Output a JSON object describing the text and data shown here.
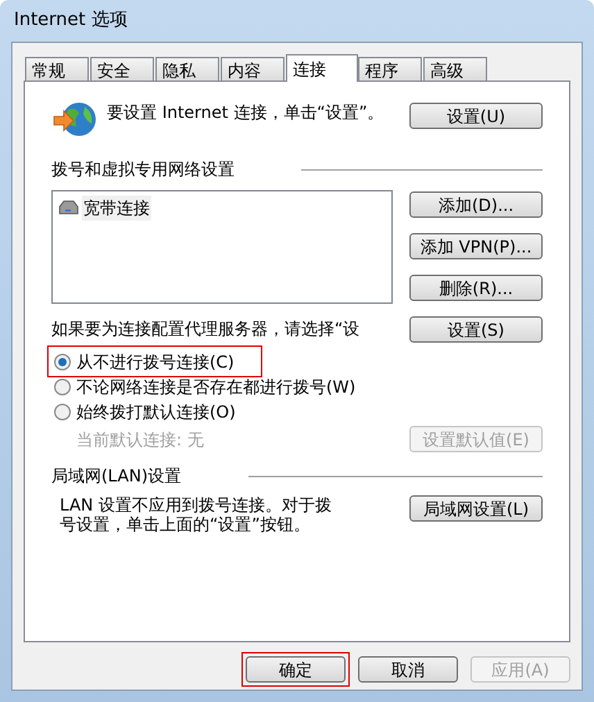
{
  "window": {
    "title": "Internet 选项"
  },
  "tabs": [
    {
      "label": "常规",
      "selected": false
    },
    {
      "label": "安全",
      "selected": false
    },
    {
      "label": "隐私",
      "selected": false
    },
    {
      "label": "内容",
      "selected": false
    },
    {
      "label": "连接",
      "selected": true
    },
    {
      "label": "程序",
      "selected": false
    },
    {
      "label": "高级",
      "selected": false
    }
  ],
  "setup": {
    "text": "要设置 Internet 连接，单击“设置”。",
    "button": "设置(U)"
  },
  "dialup": {
    "heading": "拨号和虚拟专用网络设置",
    "connections": [
      "宽带连接"
    ],
    "buttons": [
      "添加(D)...",
      "添加 VPN(P)...",
      "删除(R)..."
    ]
  },
  "proxy": {
    "text": "如果要为连接配置代理服务器，请选择“设",
    "button": "设置(S)"
  },
  "radios": [
    {
      "label": "从不进行拨号连接(C)",
      "selected": true,
      "highlighted": true
    },
    {
      "label": "不论网络连接是否存在都进行拨号(W)",
      "selected": false,
      "highlighted": false
    },
    {
      "label": "始终拨打默认连接(O)",
      "selected": false,
      "highlighted": false
    }
  ],
  "default_connection": {
    "text": "当前默认连接: 无",
    "disabled": true,
    "button": "设置默认值(E)"
  },
  "lan": {
    "heading": "局域网(LAN)设置",
    "text": "LAN 设置不应用到拨号连接。对于拨号设置，单击上面的“设置”按钮。",
    "button": "局域网设置(L)"
  },
  "footer_buttons": [
    {
      "label": "确定",
      "disabled": false,
      "highlighted": true
    },
    {
      "label": "取消",
      "disabled": false,
      "highlighted": false
    },
    {
      "label": "应用(A)",
      "disabled": true,
      "highlighted": false
    }
  ]
}
